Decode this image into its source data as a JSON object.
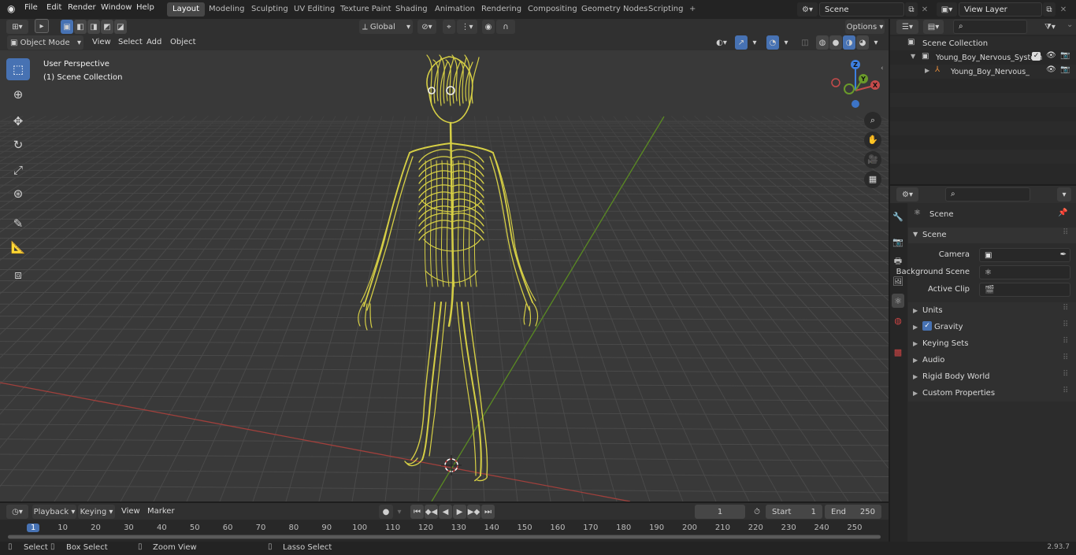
{
  "topbar": {
    "app_icon": "blender-logo-icon",
    "menus": [
      "File",
      "Edit",
      "Render",
      "Window",
      "Help"
    ],
    "workspaces": [
      "Layout",
      "Modeling",
      "Sculpting",
      "UV Editing",
      "Texture Paint",
      "Shading",
      "Animation",
      "Rendering",
      "Compositing",
      "Geometry Nodes",
      "Scripting"
    ],
    "active_workspace": "Layout",
    "add_workspace": "+",
    "scene_name": "Scene",
    "view_layer": "View Layer"
  },
  "viewport": {
    "mode": "Object Mode",
    "menus": [
      "View",
      "Select",
      "Add",
      "Object"
    ],
    "transform_orientation": "Global",
    "options": "Options",
    "overlay_title": "User Perspective",
    "overlay_subtitle": "(1) Scene Collection",
    "gizmo_axes": [
      "X",
      "Y",
      "Z"
    ],
    "tools": [
      "select-box-icon",
      "cursor-icon",
      "move-icon",
      "rotate-icon",
      "scale-icon",
      "transform-icon",
      "annotate-icon",
      "measure-icon",
      "add-cube-icon"
    ]
  },
  "outliner": {
    "root": "Scene Collection",
    "items": [
      "Young_Boy_Nervous_System",
      "Young_Boy_Nervous_Sys"
    ]
  },
  "properties": {
    "context": "Scene",
    "panel_title": "Scene",
    "fields": [
      {
        "label": "Camera",
        "value": ""
      },
      {
        "label": "Background Scene",
        "value": ""
      },
      {
        "label": "Active Clip",
        "value": ""
      }
    ],
    "sections": [
      "Units",
      "Gravity",
      "Keying Sets",
      "Audio",
      "Rigid Body World",
      "Custom Properties"
    ],
    "gravity_enabled": true
  },
  "timeline": {
    "menus": [
      "Playback",
      "Keying",
      "View",
      "Marker"
    ],
    "current_frame": "1",
    "start_label": "Start",
    "start": "1",
    "end_label": "End",
    "end": "250",
    "ruler": [
      "1",
      "10",
      "20",
      "30",
      "40",
      "50",
      "60",
      "70",
      "80",
      "90",
      "100",
      "110",
      "120",
      "130",
      "140",
      "150",
      "160",
      "170",
      "180",
      "190",
      "200",
      "210",
      "220",
      "230",
      "240",
      "250"
    ]
  },
  "statusbar": {
    "items": [
      "Select",
      "Box Select",
      "Zoom View",
      "Lasso Select"
    ],
    "version": "2.93.7"
  },
  "colors": {
    "accent": "#4772b3",
    "model": "#d6cf45",
    "x_axis": "#b8433f",
    "y_axis": "#6a9a2a",
    "z_axis": "#3d7fe0"
  }
}
